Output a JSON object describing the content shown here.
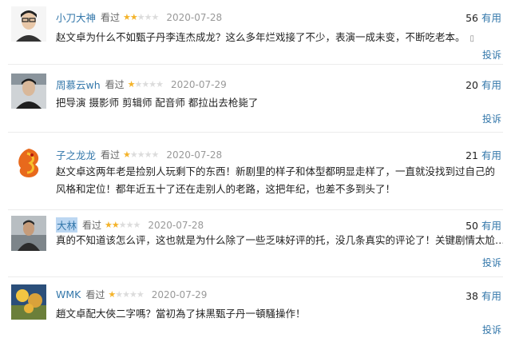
{
  "reviews": [
    {
      "user": "小刀大神",
      "status": "看过",
      "stars_on": "★★",
      "stars_off": "★★★",
      "rating": 2,
      "date": "2020-07-28",
      "votes": "56",
      "votes_label": "有用",
      "content": "赵文卓为什么不如甄子丹李连杰成龙？这么多年烂戏接了不少，表演一成未变，不断吃老本。",
      "device_icon": "phone-icon",
      "report": "投诉"
    },
    {
      "user": "周慕云wh",
      "status": "看过",
      "stars_on": "★",
      "stars_off": "★★★★",
      "rating": 1,
      "date": "2020-07-29",
      "votes": "20",
      "votes_label": "有用",
      "content": "把导演 摄影师 剪辑师 配音师 都拉出去枪毙了",
      "report": "投诉"
    },
    {
      "user": "子之龙龙",
      "status": "看过",
      "stars_on": "★",
      "stars_off": "★★★★",
      "rating": 1,
      "date": "2020-07-28",
      "votes": "21",
      "votes_label": "有用",
      "content": "赵文卓这两年老是捡别人玩剩下的东西！新剧里的样子和体型都明显走样了，一直就没找到过自己的风格和定位！都年近五十了还在走别人的老路，这把年纪，也差不多到头了！",
      "report": "投诉"
    },
    {
      "user": "大林",
      "status": "看过",
      "stars_on": "★★",
      "stars_off": "★★★",
      "rating": 2,
      "date": "2020-07-28",
      "votes": "50",
      "votes_label": "有用",
      "content": "真的不知道该怎么评，这也就是为什么除了一些乏味好评的托，没几条真实的评论了！关键剧情太尬……",
      "report": "投诉"
    },
    {
      "user": "WMK",
      "status": "看过",
      "stars_on": "★",
      "stars_off": "★★★★",
      "rating": 1,
      "date": "2020-07-29",
      "votes": "38",
      "votes_label": "有用",
      "content": "趙文卓配大俠二字嗎？當初為了抹黑甄子丹一頓騷操作！",
      "report": "投诉"
    }
  ]
}
